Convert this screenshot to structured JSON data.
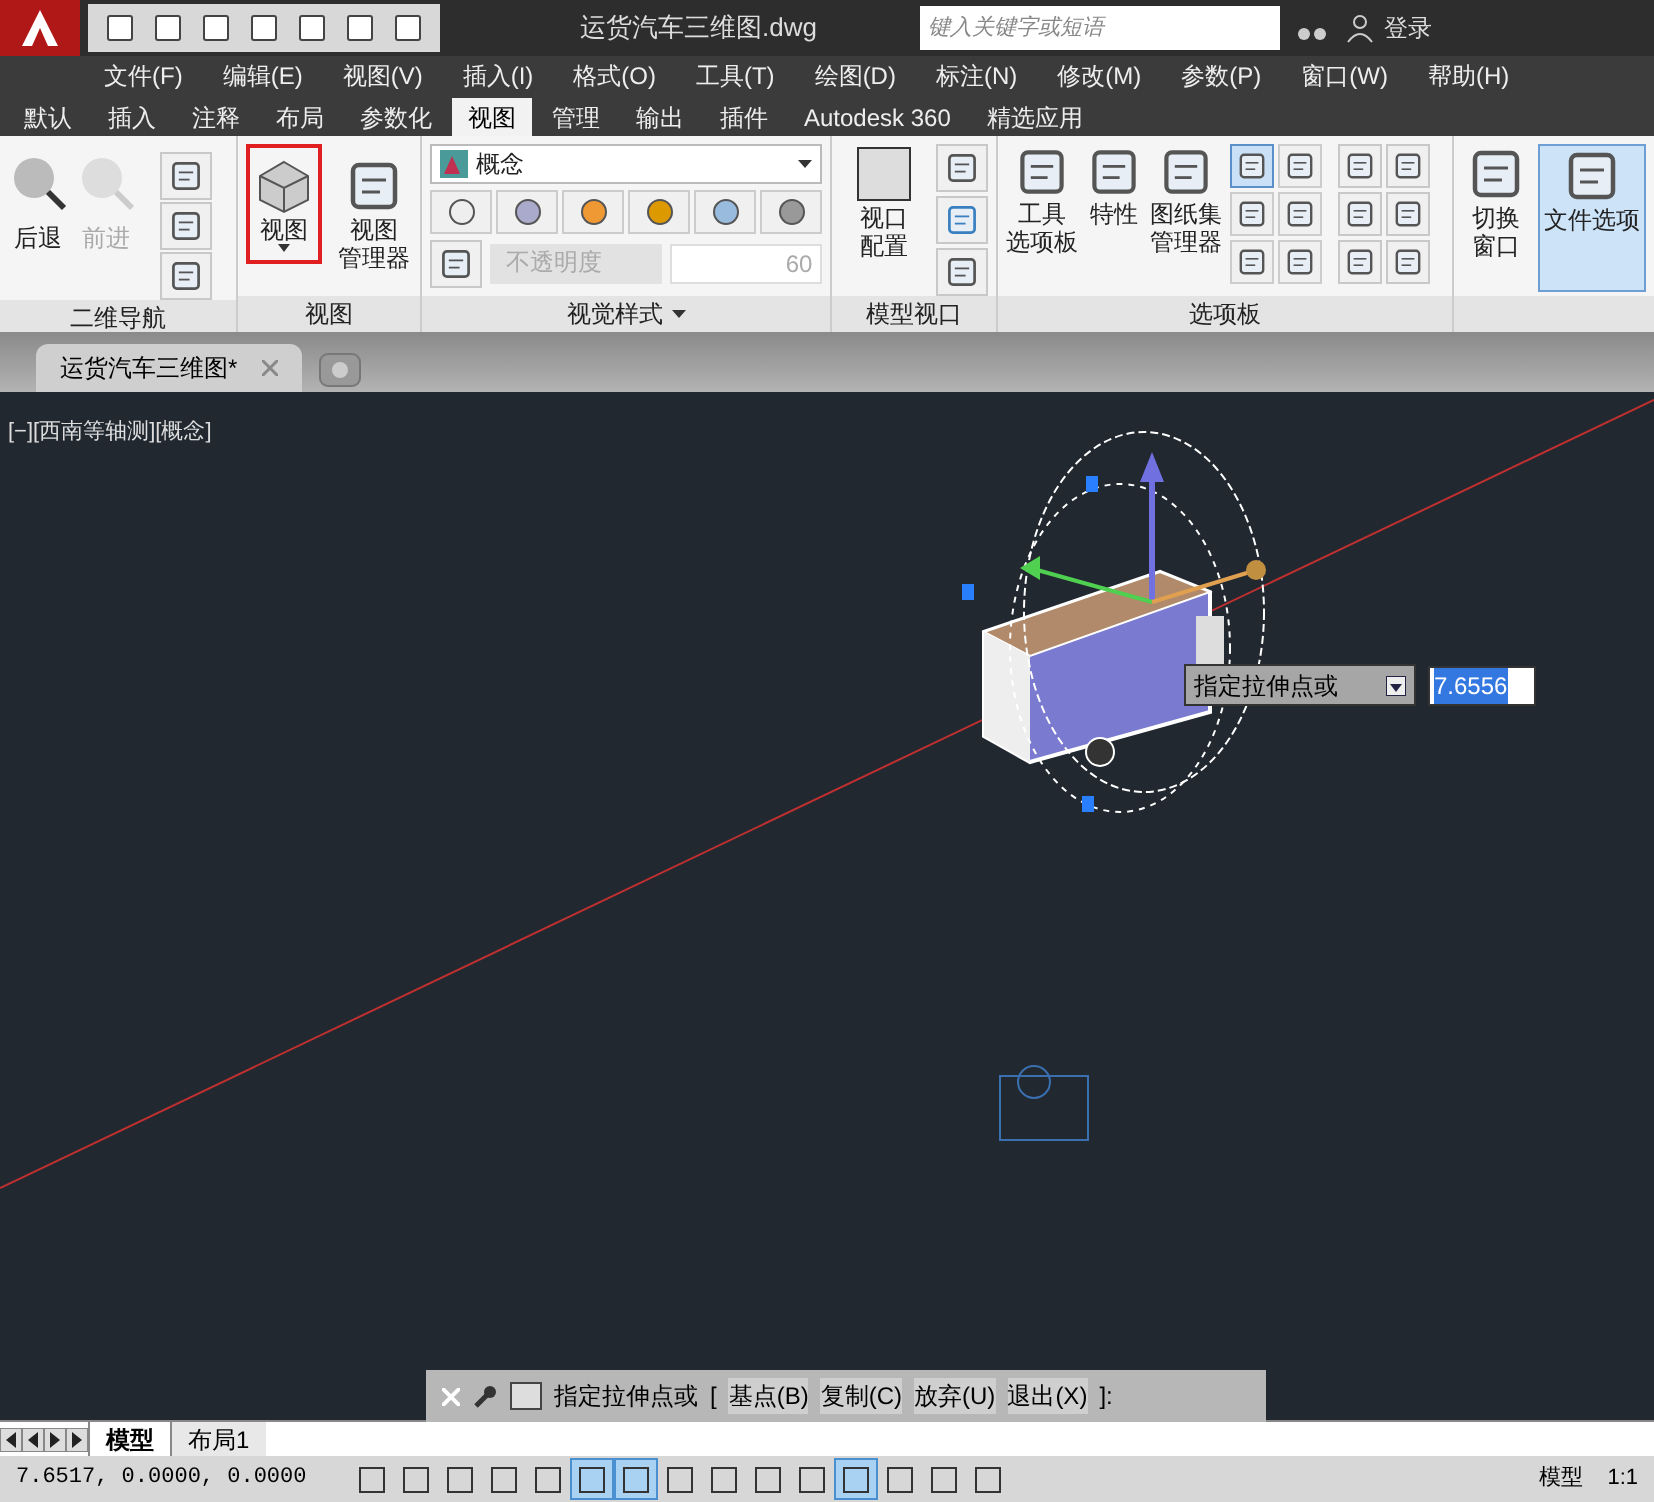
{
  "window": {
    "title": "运货汽车三维图.dwg",
    "search": {
      "placeholder": "键入关键字或短语"
    },
    "login": "登录"
  },
  "menu": [
    "文件(F)",
    "编辑(E)",
    "视图(V)",
    "插入(I)",
    "格式(O)",
    "工具(T)",
    "绘图(D)",
    "标注(N)",
    "修改(M)",
    "参数(P)",
    "窗口(W)",
    "帮助(H)"
  ],
  "ribbon_tabs": [
    {
      "label": "默认",
      "selected": false
    },
    {
      "label": "插入",
      "selected": false
    },
    {
      "label": "注释",
      "selected": false
    },
    {
      "label": "布局",
      "selected": false
    },
    {
      "label": "参数化",
      "selected": false
    },
    {
      "label": "视图",
      "selected": true
    },
    {
      "label": "管理",
      "selected": false
    },
    {
      "label": "输出",
      "selected": false
    },
    {
      "label": "插件",
      "selected": false
    },
    {
      "label": "Autodesk 360",
      "selected": false
    },
    {
      "label": "精选应用",
      "selected": false
    }
  ],
  "panels": {
    "nav": {
      "title": "二维导航",
      "buttons": [
        {
          "label": "后退",
          "disabled": false
        },
        {
          "label": "前进",
          "disabled": true
        }
      ]
    },
    "views": {
      "title": "视图",
      "buttons": [
        {
          "lines": [
            "视图"
          ],
          "highlighted": true,
          "dropdown": true
        },
        {
          "lines": [
            "视图",
            "管理器"
          ],
          "highlighted": false,
          "dropdown": false
        }
      ]
    },
    "visual_styles": {
      "title": "视觉样式",
      "style": "概念",
      "opacity_label": "不透明度",
      "opacity_value": "60"
    },
    "model_viewports": {
      "title": "模型视口",
      "button": [
        "视口",
        "配置"
      ]
    },
    "palettes": {
      "title": "选项板",
      "buttons": [
        [
          "工具",
          "选项板"
        ],
        [
          "特性"
        ],
        [
          "图纸集",
          "管理器"
        ]
      ],
      "small_active": [
        true,
        false,
        false,
        false,
        false,
        false
      ]
    },
    "window": {
      "buttons": [
        {
          "lines": [
            "切换",
            "窗口"
          ],
          "selected": false
        },
        {
          "lines": [
            "文件选项"
          ],
          "selected": true
        }
      ]
    }
  },
  "document_tabs": [
    {
      "label": "运货汽车三维图*",
      "selected": true
    }
  ],
  "viewport_label": "[−][西南等轴测][概念]",
  "dynamic_input": {
    "prompt": "指定拉伸点或",
    "value": "7.6556"
  },
  "command_line": {
    "prompt": "指定拉伸点或",
    "open": "[",
    "options": [
      "基点(B)",
      "复制(C)",
      "放弃(U)",
      "退出(X)"
    ],
    "close": "]:"
  },
  "layout_tabs": [
    {
      "label": "模型",
      "selected": true
    },
    {
      "label": "布局1",
      "selected": false
    }
  ],
  "status_bar": {
    "coordinates": "7.6517, 0.0000, 0.0000",
    "toggles": [
      {
        "on": false
      },
      {
        "on": false
      },
      {
        "on": false
      },
      {
        "on": false
      },
      {
        "on": false
      },
      {
        "on": true
      },
      {
        "on": true
      },
      {
        "on": false
      },
      {
        "on": false
      },
      {
        "on": false
      },
      {
        "on": false
      },
      {
        "on": true
      },
      {
        "on": false
      },
      {
        "on": false
      },
      {
        "on": false
      }
    ],
    "space": "模型",
    "scale": "1:1"
  }
}
